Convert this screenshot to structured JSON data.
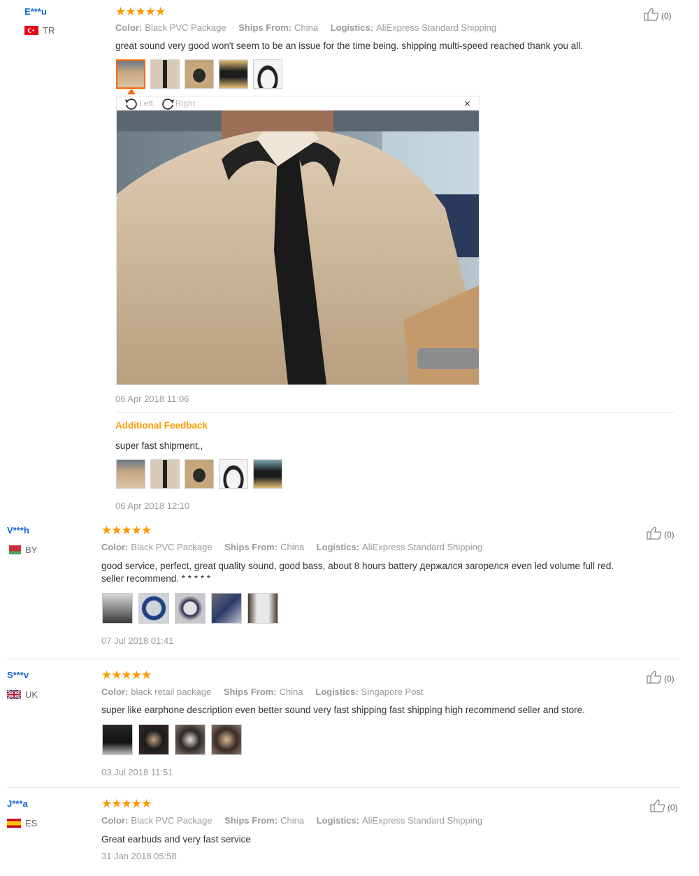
{
  "reviews": [
    {
      "user": "E***u",
      "country": "TR",
      "stars": "★★★★★",
      "color_label": "Color:",
      "color": "Black PVC Package",
      "ships_label": "Ships From:",
      "ships": "China",
      "logistics_label": "Logistics:",
      "logistics": "AliExpress Standard Shipping",
      "text": "great sound very good won't seem to be an issue for the time being. shipping multi-speed reached thank you all.",
      "date": "06 Apr 2018 11:06",
      "likes": "(0)",
      "additional_title": "Additional Feedback",
      "additional_text": "super fast shipment,,",
      "additional_date": "06 Apr 2018 12:10"
    },
    {
      "user": "V***h",
      "country": "BY",
      "stars": "★★★★★",
      "color_label": "Color:",
      "color": "Black PVC Package",
      "ships_label": "Ships From:",
      "ships": "China",
      "logistics_label": "Logistics:",
      "logistics": "AliExpress Standard Shipping",
      "text": "good service, perfect, great quality sound, good bass, about 8 hours battery держался загорелся even led volume full red.",
      "text2": "seller recommend. * * * * *",
      "date": "07 Jul 2018 01:41",
      "likes": "(0)"
    },
    {
      "user": "S***v",
      "country": "UK",
      "stars": "★★★★★",
      "color_label": "Color:",
      "color": "black retail package",
      "ships_label": "Ships From:",
      "ships": "China",
      "logistics_label": "Logistics:",
      "logistics": "Singapore Post",
      "text": "super like earphone description even better sound very fast shipping fast shipping high recommend seller and store.",
      "date": "03 Jul 2018 11:51",
      "likes": "(0)"
    },
    {
      "user": "J***a",
      "country": "ES",
      "stars": "★★★★★",
      "color_label": "Color:",
      "color": "Black PVC Package",
      "ships_label": "Ships From:",
      "ships": "China",
      "logistics_label": "Logistics:",
      "logistics": "AliExpress Standard Shipping",
      "text": "Great earbuds and very fast service",
      "date": "31 Jan 2018 05:58",
      "likes": "(0)"
    }
  ],
  "viewer": {
    "rotate_left": "Left",
    "rotate_right": "Right",
    "close": "×"
  },
  "colors": {
    "accent": "#ff6600",
    "star": "#ff9900",
    "username": "#1464d2"
  }
}
